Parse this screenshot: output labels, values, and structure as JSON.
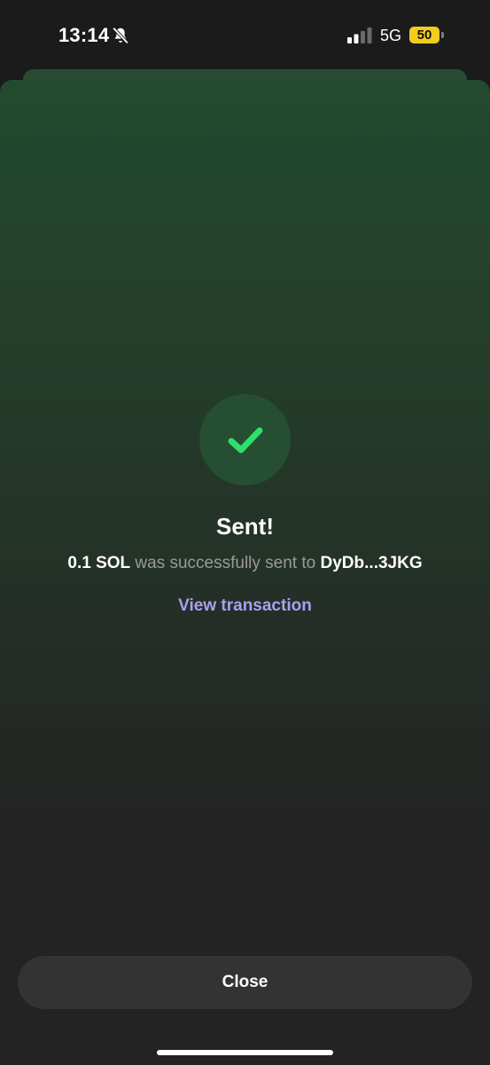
{
  "status_bar": {
    "time": "13:14",
    "mute_icon": "bell-slash-icon",
    "signal_icon": "cellular-signal-icon",
    "network": "5G",
    "battery": "50"
  },
  "result": {
    "icon": "checkmark-icon",
    "title": "Sent!",
    "amount": "0.1 SOL",
    "message_middle": " was successfully sent to ",
    "recipient": "DyDb...3JKG",
    "view_link": "View transaction"
  },
  "footer": {
    "close_label": "Close"
  },
  "colors": {
    "accent_link": "#ab9ff2",
    "success_check": "#2ee06b",
    "battery": "#f2cc1f"
  }
}
